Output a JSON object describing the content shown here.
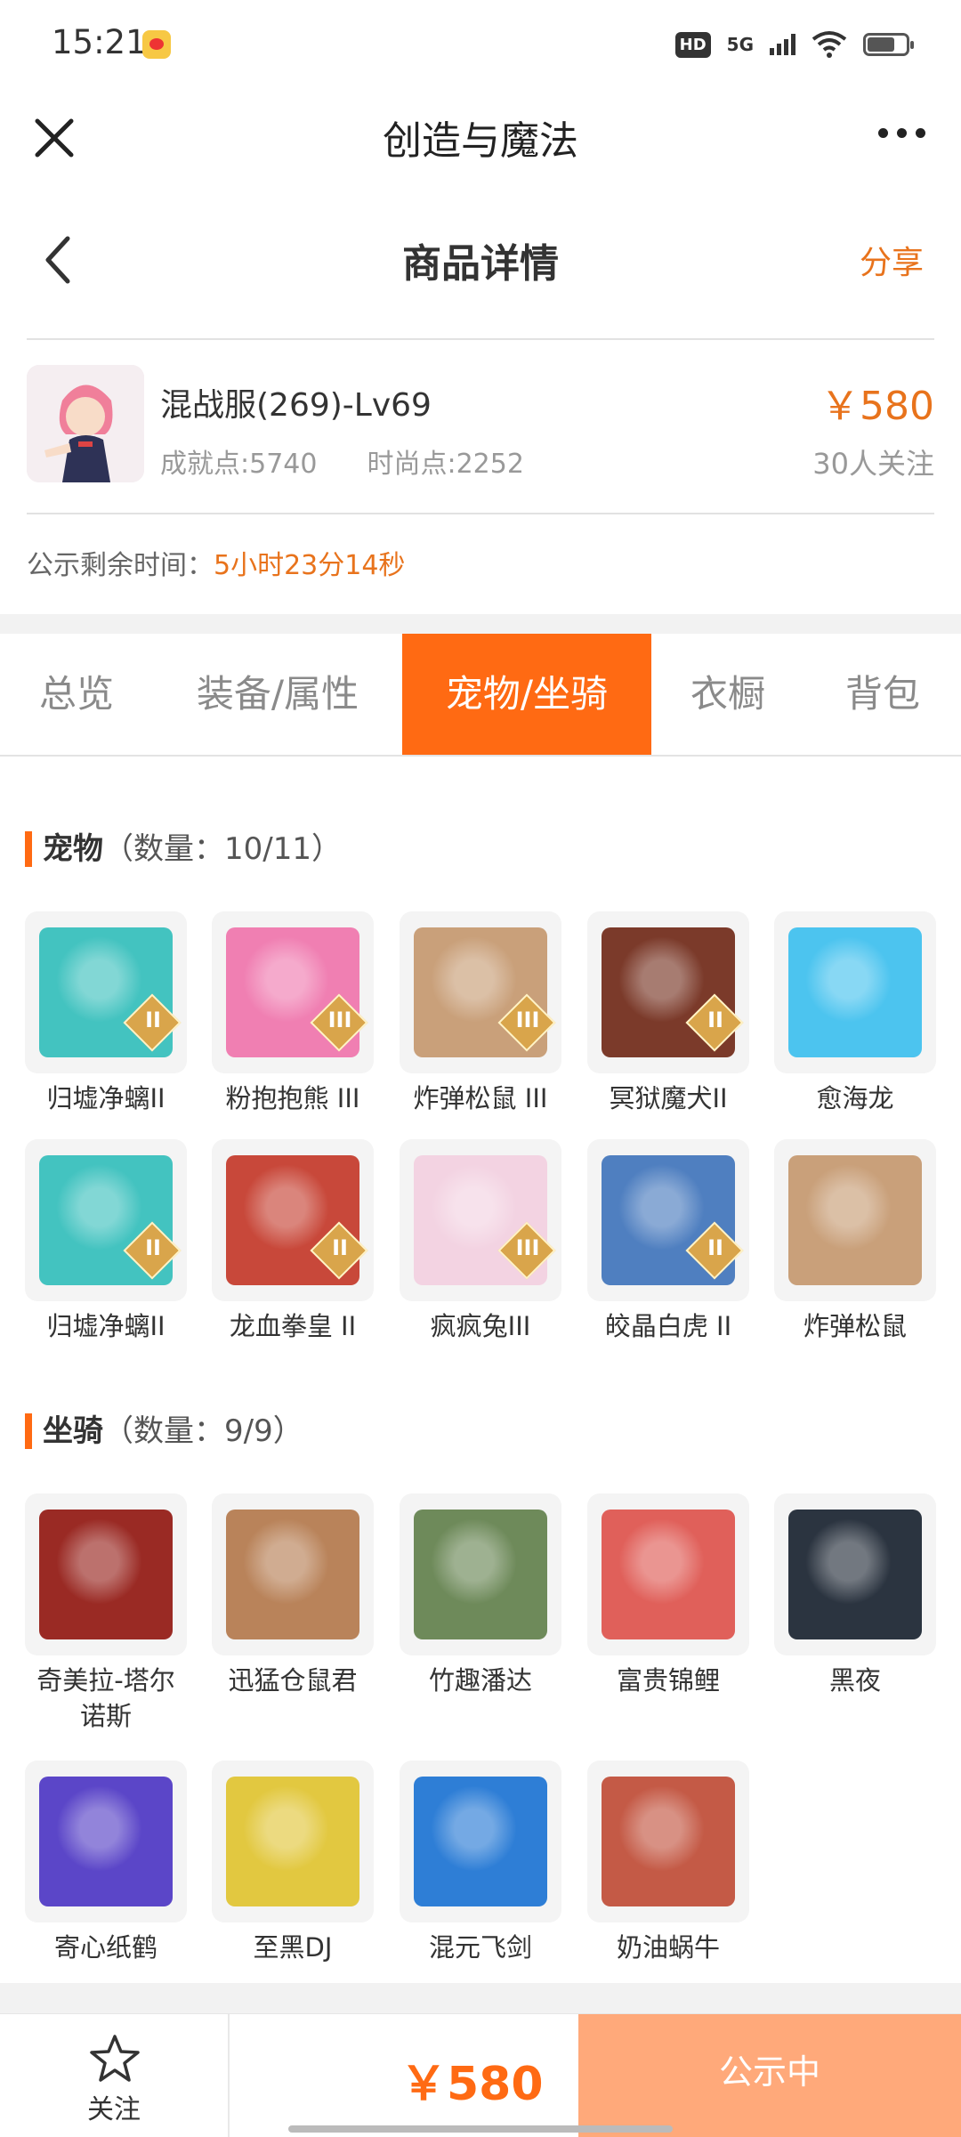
{
  "status_bar": {
    "time": "15:21",
    "hd": "HD",
    "network": "5G"
  },
  "app": {
    "title": "创造与魔法"
  },
  "nav": {
    "title": "商品详情",
    "share": "分享"
  },
  "product": {
    "name": "混战服(269)-Lv69",
    "achievement": "成就点:5740",
    "fashion": "时尚点:2252",
    "price": "￥580",
    "follows": "30人关注",
    "countdown_label": "公示剩余时间：",
    "countdown_value": "5小时23分14秒"
  },
  "tabs": [
    "总览",
    "装备/属性",
    "宠物/坐骑",
    "衣橱",
    "背包"
  ],
  "active_tab_index": 2,
  "pets": {
    "title": "宠物",
    "count": "（数量：10/11）",
    "items": [
      {
        "name": "归墟净螭II",
        "badge": "II",
        "color": "#43c3c0"
      },
      {
        "name": "粉抱抱熊 III",
        "badge": "III",
        "color": "#f07fb2"
      },
      {
        "name": "炸弹松鼠 III",
        "badge": "III",
        "color": "#c9a07a"
      },
      {
        "name": "冥狱魔犬II",
        "badge": "II",
        "color": "#7b3a2a"
      },
      {
        "name": "愈海龙",
        "badge": "",
        "color": "#4cc4ef"
      },
      {
        "name": "归墟净螭II",
        "badge": "II",
        "color": "#43c3c0"
      },
      {
        "name": "龙血拳皇 II",
        "badge": "II",
        "color": "#c8483a"
      },
      {
        "name": "疯疯兔III",
        "badge": "III",
        "color": "#f3d3e2"
      },
      {
        "name": "皎晶白虎 II",
        "badge": "II",
        "color": "#4f7fc0"
      },
      {
        "name": "炸弹松鼠",
        "badge": "",
        "color": "#c9a07a"
      }
    ]
  },
  "mounts": {
    "title": "坐骑",
    "count": "（数量：9/9）",
    "items": [
      {
        "name": "奇美拉-塔尔诺斯",
        "badge": "",
        "color": "#9a2a24"
      },
      {
        "name": "迅猛仓鼠君",
        "badge": "",
        "color": "#b9835a"
      },
      {
        "name": "竹趣潘达",
        "badge": "",
        "color": "#6e8a5a"
      },
      {
        "name": "富贵锦鲤",
        "badge": "",
        "color": "#e0605a"
      },
      {
        "name": "黑夜",
        "badge": "",
        "color": "#2b3440"
      },
      {
        "name": "寄心纸鹤",
        "badge": "",
        "color": "#5b46c8"
      },
      {
        "name": "至黑DJ",
        "badge": "",
        "color": "#e2c840"
      },
      {
        "name": "混元飞剑",
        "badge": "",
        "color": "#2e7ed6"
      },
      {
        "name": "奶油蜗牛",
        "badge": "",
        "color": "#c45a46"
      }
    ]
  },
  "bottom": {
    "follow_label": "关注",
    "price": "￥580",
    "status": "公示中"
  }
}
